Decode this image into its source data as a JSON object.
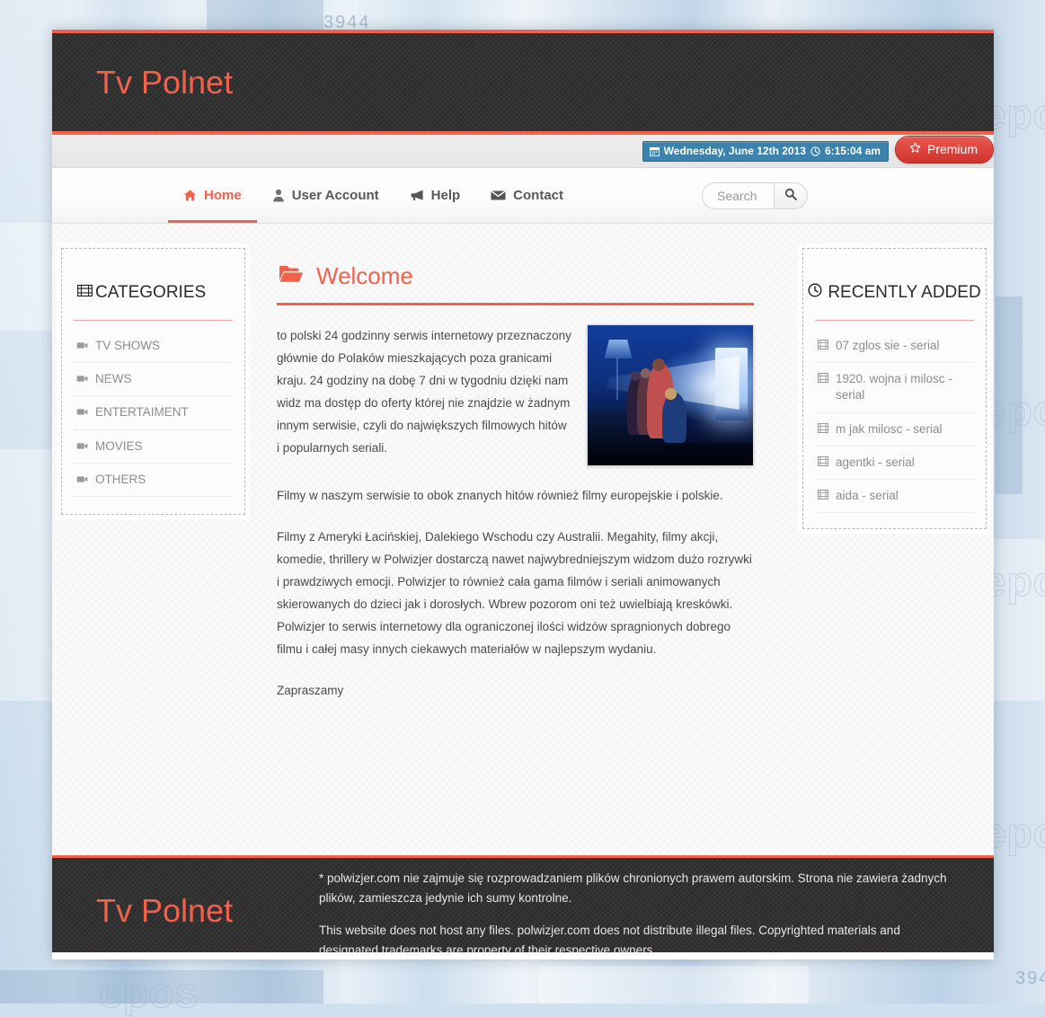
{
  "site": {
    "logo": "Tv Polnet",
    "footer_logo": "Tv Polnet"
  },
  "utility_bar": {
    "datetime": "Wednesday, June 12th 2013",
    "time": "6:15:04 am",
    "calendar_icon": "calendar-icon",
    "clock_icon": "clock-icon",
    "premium_label": "Premium",
    "premium_icon": "star-icon",
    "badge_color": "#3b82ad",
    "premium_color": "#d0342c"
  },
  "nav": {
    "items": [
      {
        "label": "Home",
        "icon": "home-icon",
        "active": true
      },
      {
        "label": "User Account",
        "icon": "user-icon",
        "active": false
      },
      {
        "label": "Help",
        "icon": "bullhorn-icon",
        "active": false
      },
      {
        "label": "Contact",
        "icon": "envelope-icon",
        "active": false
      }
    ],
    "accent_color": "#f2624a"
  },
  "search": {
    "placeholder": "Search",
    "value": "",
    "button_icon": "search-icon"
  },
  "categories": {
    "title": "CATEGORIES",
    "icon": "film-icon",
    "items": [
      {
        "label": "TV SHOWS",
        "icon": "video-camera-icon"
      },
      {
        "label": "NEWS",
        "icon": "video-camera-icon"
      },
      {
        "label": "ENTERTAIMENT",
        "icon": "video-camera-icon"
      },
      {
        "label": "MOVIES",
        "icon": "video-camera-icon"
      },
      {
        "label": "OTHERS",
        "icon": "video-camera-icon"
      }
    ]
  },
  "recently_added": {
    "title": "RECENTLY ADDED",
    "icon": "clock-icon",
    "items": [
      {
        "label": "07 zglos sie - serial",
        "icon": "film-strip-icon"
      },
      {
        "label": "1920. wojna i milosc - serial",
        "icon": "film-strip-icon"
      },
      {
        "label": "m jak milosc - serial",
        "icon": "film-strip-icon"
      },
      {
        "label": "agentki - serial",
        "icon": "film-strip-icon"
      },
      {
        "label": "aida - serial",
        "icon": "film-strip-icon"
      }
    ]
  },
  "main": {
    "heading": "Welcome",
    "heading_icon": "folder-open-icon",
    "intro": "to polski 24 godzinny serwis internetowy przeznaczony głównie do Polaków mieszkających poza granicami kraju. 24 godziny na dobę 7 dni w tygodniu dzięki nam widz ma dostęp do oferty której nie znajdzie w żadnym innym serwisie, czyli do największych filmowych hitów i popularnych seriali.",
    "image_alt": "family watching television in dark room",
    "paragraphs": [
      "Filmy w naszym serwisie to obok znanych hitów również filmy europejskie i polskie.",
      "Filmy z Ameryki Łacińskiej, Dalekiego Wschodu czy Australii. Megahity, filmy akcji, komedie, thrillery w Polwizjer dostarczą nawet najwybredniejszym widzom dużo rozrywki i prawdziwych emocji. Polwizjer to również cała gama filmów i seriali animowanych skierowanych do dzieci jak i dorosłych. Wbrew pozorom oni też uwielbiają kreskówki. Polwizjer to serwis internetowy dla ograniczonej ilości widzów spragnionych dobrego filmu i całej masy innych ciekawych materiałów w najlepszym wydaniu.",
      "Zapraszamy"
    ]
  },
  "footer": {
    "disclaimer_pl": "* polwizjer.com nie zajmuje się rozprowadzaniem plików chronionych prawem autorskim. Strona nie zawiera żadnych plików, zamieszcza jedynie ich sumy kontrolne.",
    "disclaimer_en": "This website does not host any files. polwizjer.com does not distribute illegal files. Copyrighted materials and designated trademarks are property of their respective owners."
  },
  "background": {
    "watermark": "epos",
    "top_number": "3944"
  }
}
